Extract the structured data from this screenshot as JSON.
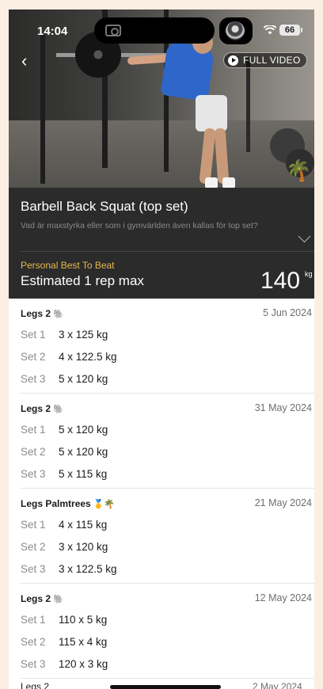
{
  "status": {
    "time": "14:04",
    "battery": "66"
  },
  "video": {
    "full_video_label": "FULL VIDEO"
  },
  "exercise": {
    "title": "Barbell Back Squat (top set)",
    "description": "Vad är maxstyrka eller som i gymvärlden även kallas för top set?"
  },
  "personal_best": {
    "label": "Personal Best To Beat",
    "name": "Estimated 1 rep max",
    "value": "140",
    "unit": "kg"
  },
  "workouts": [
    {
      "name": "Legs 2",
      "emoji": "🐘",
      "date": "5 Jun 2024",
      "sets": [
        {
          "label": "Set 1",
          "value": "3 x 125 kg"
        },
        {
          "label": "Set 2",
          "value": "4 x 122.5 kg"
        },
        {
          "label": "Set 3",
          "value": "5 x 120 kg"
        }
      ]
    },
    {
      "name": "Legs 2",
      "emoji": "🐘",
      "date": "31 May 2024",
      "sets": [
        {
          "label": "Set 1",
          "value": "5 x 120 kg"
        },
        {
          "label": "Set 2",
          "value": "5 x 120 kg"
        },
        {
          "label": "Set 3",
          "value": "5 x 115 kg"
        }
      ]
    },
    {
      "name": "Legs Palmtrees",
      "emoji": "🥇🌴",
      "date": "21 May 2024",
      "sets": [
        {
          "label": "Set 1",
          "value": "4 x 115 kg"
        },
        {
          "label": "Set 2",
          "value": "3 x 120 kg"
        },
        {
          "label": "Set 3",
          "value": "3 x 122.5 kg"
        }
      ]
    },
    {
      "name": "Legs 2",
      "emoji": "🐘",
      "date": "12 May 2024",
      "sets": [
        {
          "label": "Set 1",
          "value": "110 x 5 kg"
        },
        {
          "label": "Set 2",
          "value": "115 x 4 kg"
        },
        {
          "label": "Set 3",
          "value": "120 x 3 kg"
        }
      ]
    }
  ],
  "peek_row": {
    "name": "Legs 2",
    "date": "2 May 2024"
  }
}
